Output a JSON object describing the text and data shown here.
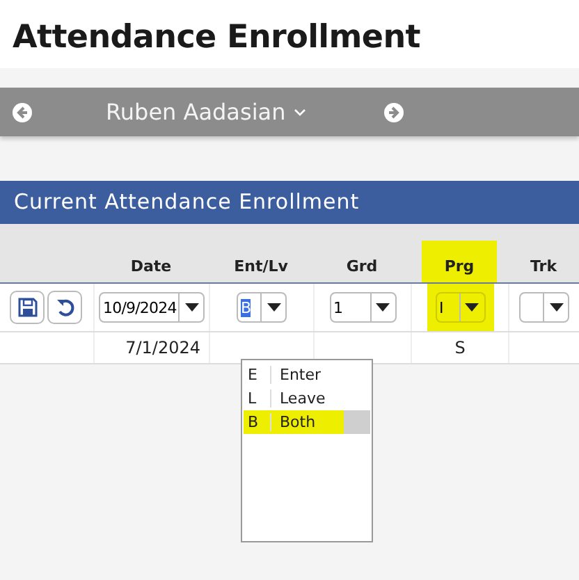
{
  "page_title": "Attendance Enrollment",
  "student_bar": {
    "student_name": "Ruben Aadasian"
  },
  "section": {
    "title": "Current Attendance Enrollment",
    "columns": [
      {
        "label": "Date",
        "highlighted": false
      },
      {
        "label": "Ent/Lv",
        "highlighted": false
      },
      {
        "label": "Grd",
        "highlighted": false
      },
      {
        "label": "Prg",
        "highlighted": true
      },
      {
        "label": "Trk",
        "highlighted": false
      }
    ],
    "edit_fields": [
      {
        "value": "10/9/2024",
        "highlighted": false
      },
      {
        "value": "B",
        "text_selected": true,
        "highlighted": false
      },
      {
        "value": "1",
        "highlighted": false
      },
      {
        "value": "I",
        "highlighted": true
      },
      {
        "highlighted": false
      }
    ],
    "rows": [
      {
        "date": "7/1/2024",
        "prg": "S"
      }
    ]
  },
  "dropdown": {
    "options": [
      {
        "code": "E",
        "label": "Enter",
        "selected": false,
        "highlighted": false
      },
      {
        "code": "L",
        "label": "Leave",
        "selected": false,
        "highlighted": false
      },
      {
        "code": "B",
        "label": "Both",
        "selected": true,
        "highlighted": true
      }
    ]
  }
}
